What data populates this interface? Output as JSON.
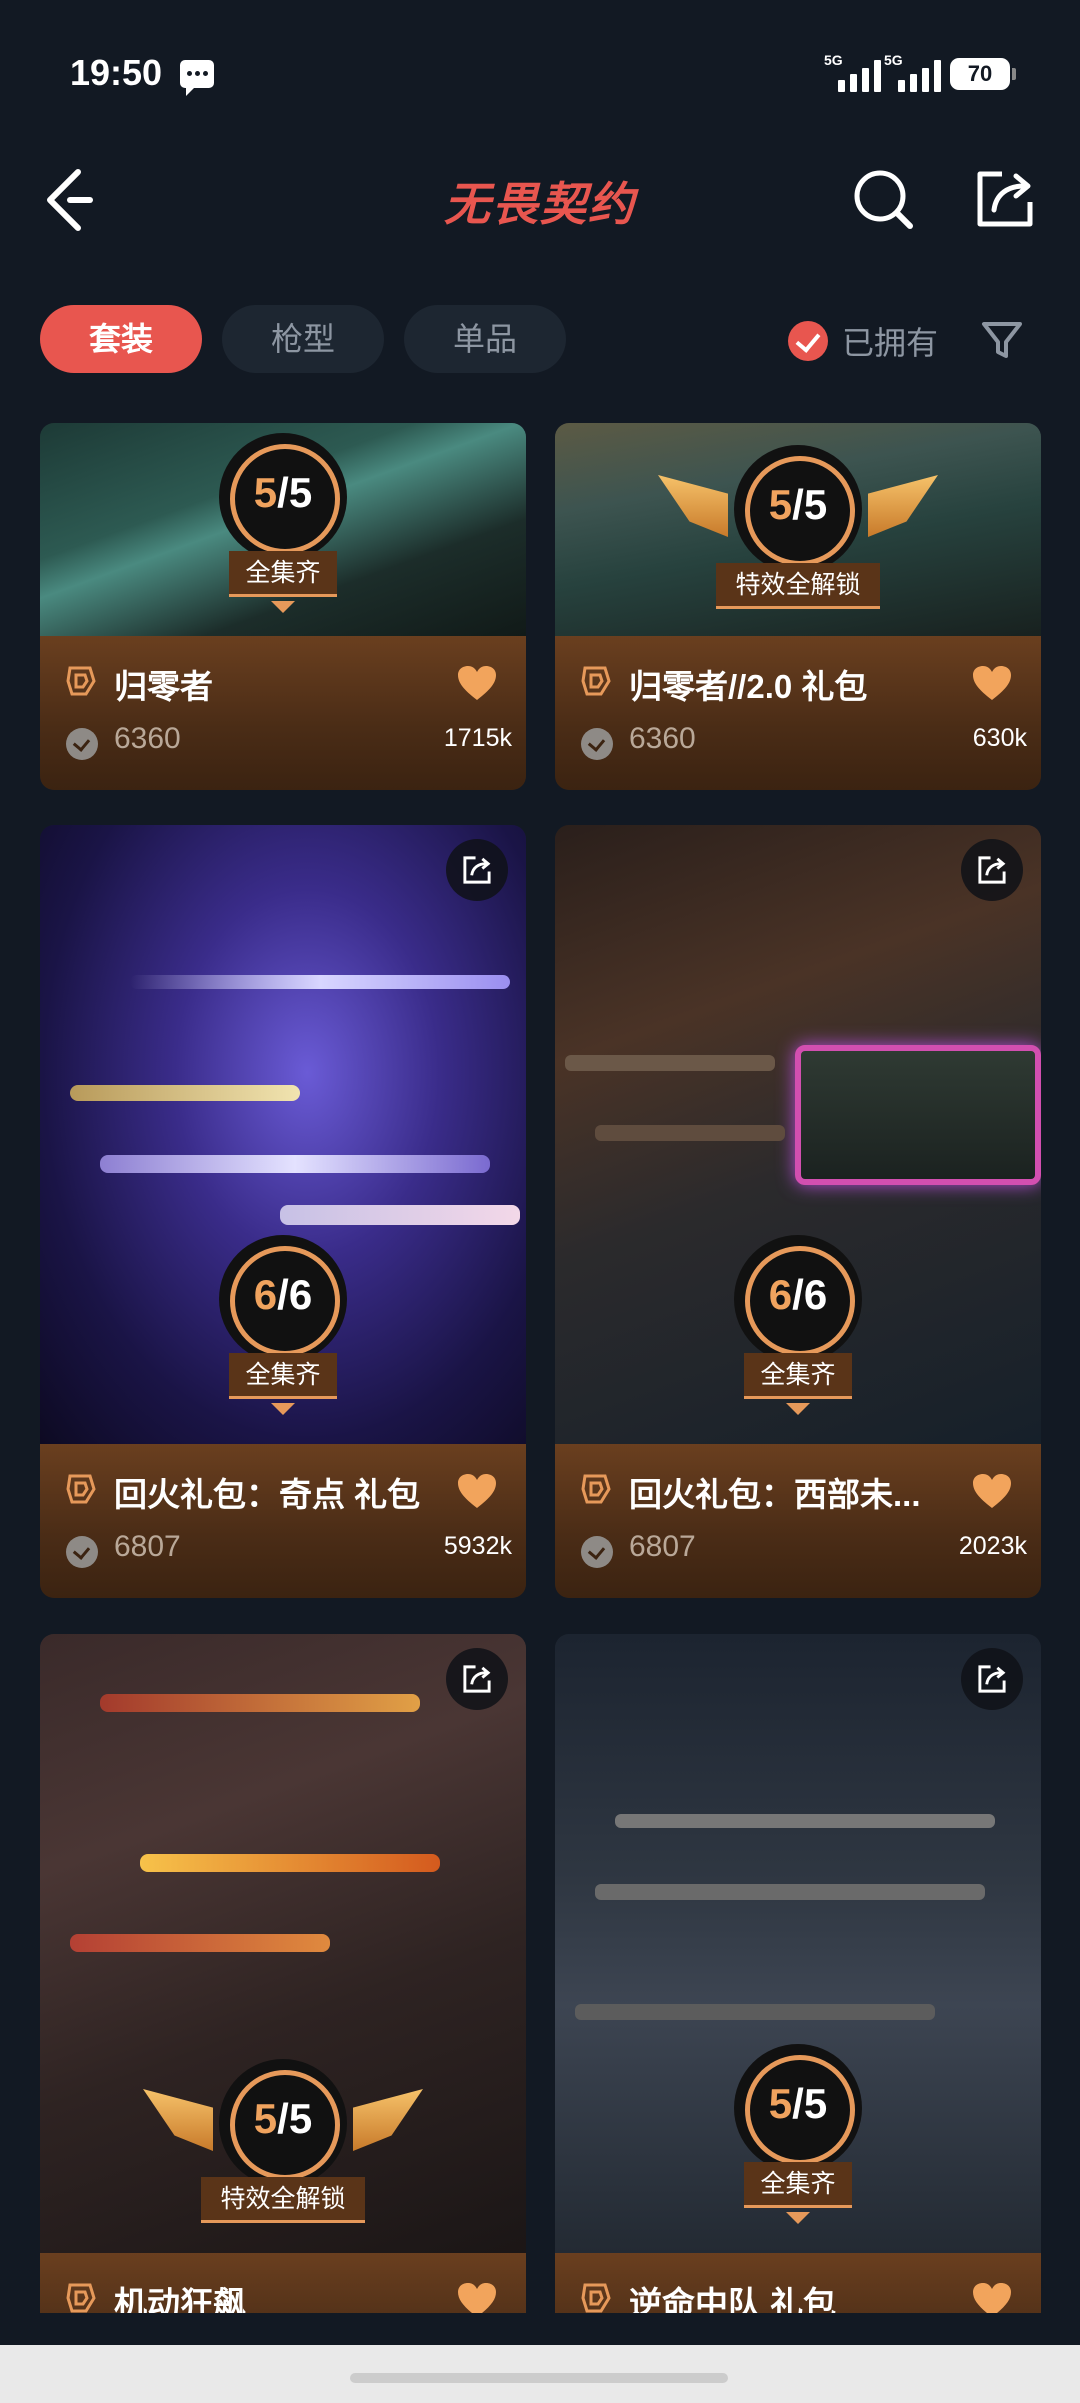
{
  "status_bar": {
    "time": "19:50",
    "sim1": "5G",
    "sim2": "5G",
    "battery": "70"
  },
  "header": {
    "title": "无畏契约"
  },
  "tabs": [
    {
      "label": "套装"
    },
    {
      "label": "枪型"
    },
    {
      "label": "单品"
    }
  ],
  "filters": {
    "owned_label": "已拥有"
  },
  "cards": [
    {
      "name": "归零者",
      "price": "6360",
      "count": "1715k",
      "progress": "5/5",
      "status": "全集齐"
    },
    {
      "name": "归零者//2.0 礼包",
      "price": "6360",
      "count": "630k",
      "progress": "5/5",
      "status": "特效全解锁"
    },
    {
      "name": "回火礼包：奇点 礼包",
      "price": "6807",
      "count": "5932k",
      "progress": "6/6",
      "status": "全集齐"
    },
    {
      "name": "回火礼包：西部未...",
      "price": "6807",
      "count": "2023k",
      "progress": "6/6",
      "status": "全集齐"
    },
    {
      "name": "机动狂飙",
      "progress": "5/5",
      "status": "特效全解锁"
    },
    {
      "name": "逆命中队 礼包",
      "progress": "5/5",
      "status": "全集齐"
    }
  ],
  "colors": {
    "accent": "#e8564f",
    "card_bg": "#4a2c16",
    "badge_ring": "#e6995a",
    "background": "#121923"
  }
}
